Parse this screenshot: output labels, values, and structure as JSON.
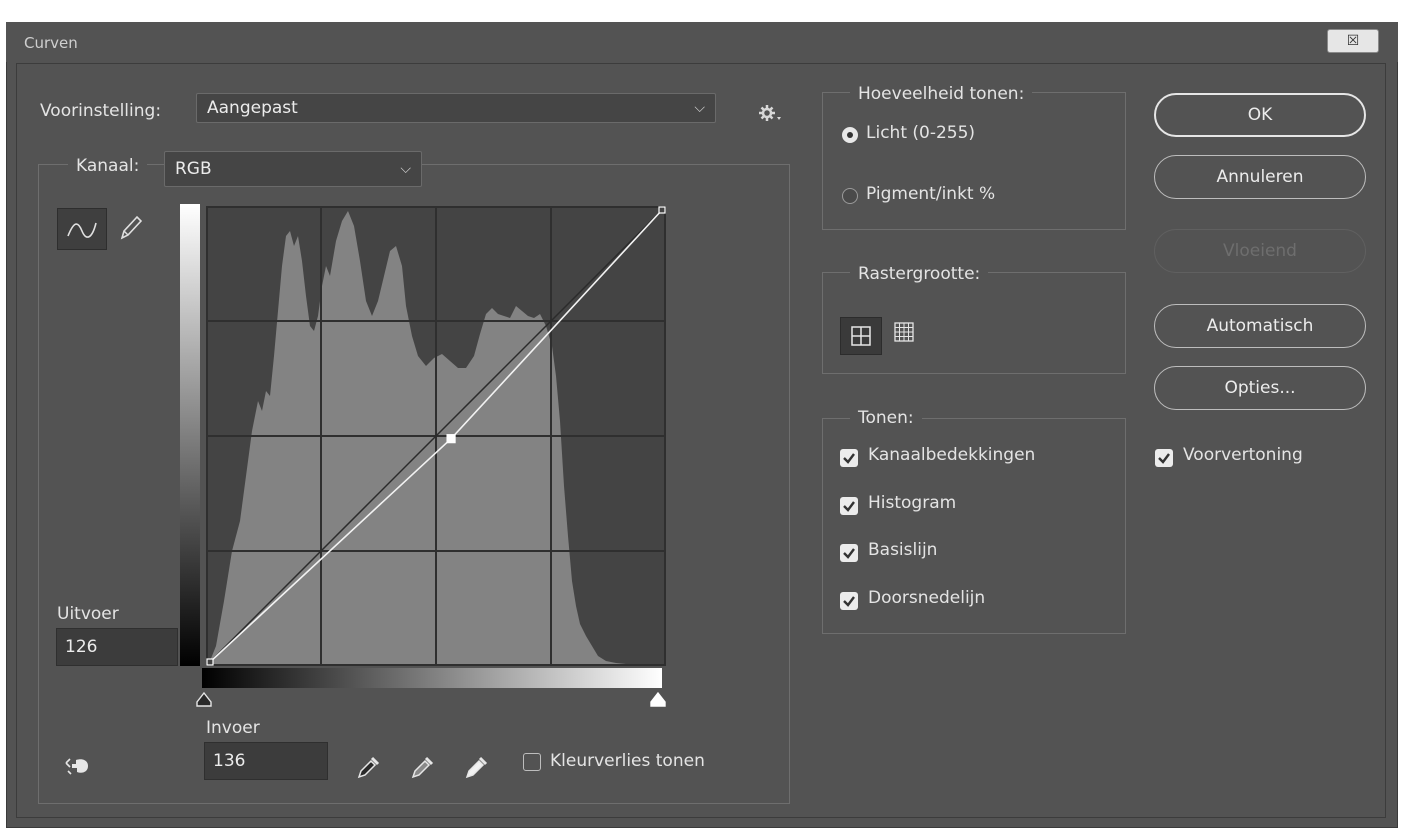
{
  "window": {
    "title": "Curven",
    "close_label": "☒"
  },
  "preset": {
    "label": "Voorinstelling:",
    "value": "Aangepast"
  },
  "channel": {
    "label": "Kanaal:",
    "value": "RGB"
  },
  "output": {
    "label": "Uitvoer",
    "value": "126"
  },
  "input": {
    "label": "Invoer",
    "value": "136"
  },
  "clipping": {
    "label": "Kleurverlies tonen",
    "checked": false
  },
  "tones_amount": {
    "legend": "Hoeveelheid tonen:",
    "options": [
      "Licht (0-255)",
      "Pigment/inkt %"
    ],
    "selected": 0
  },
  "grid_size": {
    "legend": "Rastergrootte:"
  },
  "show": {
    "legend": "Tonen:",
    "items": [
      "Kanaalbedekkingen",
      "Histogram",
      "Basislijn",
      "Doorsnedelijn"
    ]
  },
  "buttons": {
    "ok": "OK",
    "cancel": "Annuleren",
    "smooth": "Vloeiend",
    "auto": "Automatisch",
    "options": "Opties..."
  },
  "preview": {
    "label": "Voorvertoning",
    "checked": true
  },
  "curve": {
    "points": [
      [
        0,
        0
      ],
      [
        136,
        126
      ],
      [
        255,
        255
      ]
    ]
  },
  "colors": {
    "panel": "#535353",
    "graph": "#444444",
    "histogram": "#838383"
  }
}
